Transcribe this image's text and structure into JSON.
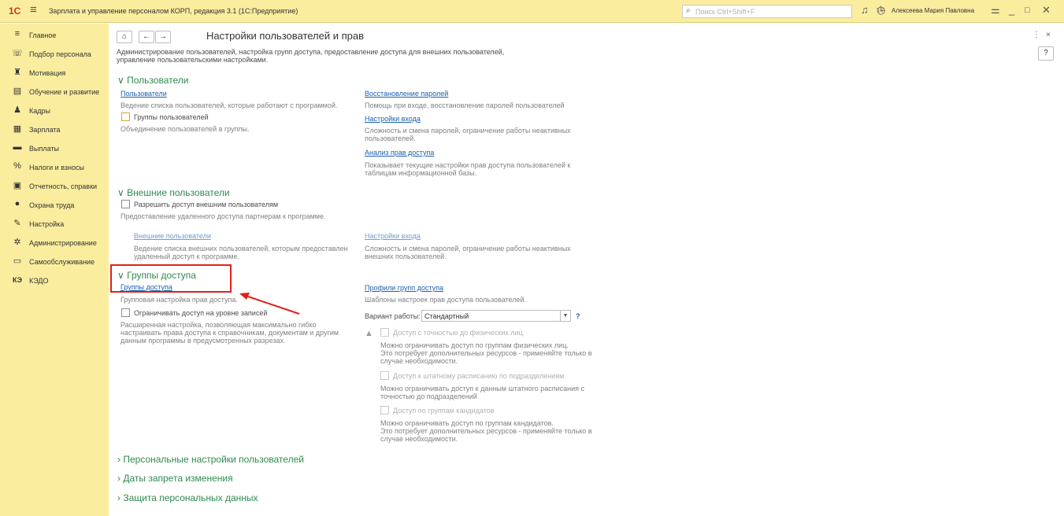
{
  "topbar": {
    "logo": "1С",
    "title": "Зарплата и управление персоналом КОРП, редакция 3.1  (1С:Предприятие)",
    "search_placeholder": "Поиск Ctrl+Shift+F",
    "user": "Алексеева Мария Павловна"
  },
  "sidebar": {
    "items": [
      {
        "label": "Главное",
        "icon": "menu-icon"
      },
      {
        "label": "Подбор персонала",
        "icon": "headset-icon"
      },
      {
        "label": "Мотивация",
        "icon": "people-icon"
      },
      {
        "label": "Обучение и развитие",
        "icon": "board-icon"
      },
      {
        "label": "Кадры",
        "icon": "staff-icon"
      },
      {
        "label": "Зарплата",
        "icon": "calculator-icon"
      },
      {
        "label": "Выплаты",
        "icon": "card-icon"
      },
      {
        "label": "Налоги и взносы",
        "icon": "percent-icon"
      },
      {
        "label": "Отчетность, справки",
        "icon": "report-icon"
      },
      {
        "label": "Охрана труда",
        "icon": "helmet-icon"
      },
      {
        "label": "Настройка",
        "icon": "wrench-icon"
      },
      {
        "label": "Администрирование",
        "icon": "gear-icon"
      },
      {
        "label": "Самообслуживание",
        "icon": "window-icon"
      },
      {
        "label": "КЭДО",
        "icon": "kedo-icon"
      }
    ]
  },
  "page": {
    "title": "Настройки пользователей и прав",
    "description_1": "Администрирование пользователей, настройка групп доступа, предоставление доступа для внешних пользователей,",
    "description_2": "управление пользовательскими настройками."
  },
  "users_section": {
    "title": "Пользователи",
    "users_link": "Пользователи",
    "users_desc": "Ведение списка пользователей, которые работают с программой.",
    "groups_checkbox": "Группы пользователей",
    "groups_desc": "Объединение пользователей в группы.",
    "password_recovery_link": "Восстановление паролей",
    "password_recovery_desc": "Помощь при входе, восстановление паролей пользователей",
    "login_settings_link": "Настройки входа",
    "login_settings_desc_1": "Сложность и смена паролей, ограничение работы неактивных",
    "login_settings_desc_2": "пользователей.",
    "rights_analysis_link": "Анализ прав доступа",
    "rights_analysis_desc_1": "Показывает текущие настройки прав доступа пользователей к",
    "rights_analysis_desc_2": "таблицам информационной базы."
  },
  "external_section": {
    "title": "Внешние пользователи",
    "allow_checkbox": "Разрешить доступ внешним пользователям",
    "allow_desc": "Предоставление удаленного доступа партнерам к программе.",
    "ext_users_link": "Внешние пользователи",
    "ext_users_desc_1": "Ведение списка внешних пользователей, которым предоставлен",
    "ext_users_desc_2": "удаленный доступ к программе.",
    "ext_login_link": "Настройки входа",
    "ext_login_desc_1": "Сложность и смена паролей, ограничение работы неактивных",
    "ext_login_desc_2": "внешних пользователей."
  },
  "access_section": {
    "title": "Группы доступа",
    "groups_link": "Группы доступа",
    "groups_desc": "Групповая настройка прав доступа.",
    "restrict_checkbox": "Ограничивать доступ на уровне записей",
    "restrict_desc_1": "Расширенная настройка, позволяющая максимально гибко",
    "restrict_desc_2": "настраивать права доступа к справочникам, документам и другим",
    "restrict_desc_3": "данным программы в предусмотренных разрезах.",
    "profiles_link": "Профили групп доступа",
    "profiles_desc": "Шаблоны настроек прав доступа пользователей.",
    "mode_label": "Вариант работы:",
    "mode_value": "Стандартный",
    "mode_help": "?",
    "opt1_label": "Доступ с точностью до физических лиц",
    "opt1_desc_1": "Можно ограничивать доступ по группам физических лиц.",
    "opt1_desc_2": "Это потребует дополнительных ресурсов - применяйте только в",
    "opt1_desc_3": "случае необходимости.",
    "opt2_label": "Доступ к штатному расписанию по подразделениям",
    "opt2_desc_1": "Можно ограничивать доступ к данным штатного расписания с",
    "opt2_desc_2": "точностью до подразделений",
    "opt3_label": "Доступ по группам кандидатов",
    "opt3_desc_1": "Можно ограничивать доступ по группам кандидатов.",
    "opt3_desc_2": "Это потребует дополнительных ресурсов - применяйте только в",
    "opt3_desc_3": "случае необходимости."
  },
  "collapsed_sections": [
    "Персональные настройки пользователей",
    "Даты запрета изменения",
    "Защита персональных данных"
  ],
  "colors": {
    "panel": "#fbed9e",
    "section_title": "#2f8a4e",
    "link": "#1c5fb0",
    "highlight": "#e0201a"
  }
}
